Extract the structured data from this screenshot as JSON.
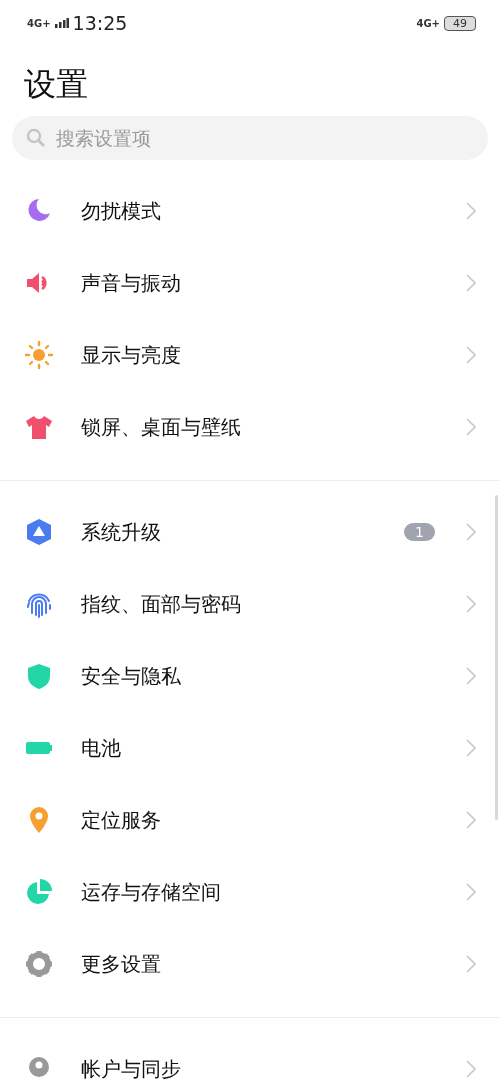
{
  "status_bar": {
    "network_left": "4G+",
    "time": "13:25",
    "network_right": "4G+",
    "battery": "49"
  },
  "title": "设置",
  "search": {
    "placeholder": "搜索设置项"
  },
  "groups": [
    {
      "items": [
        {
          "label": "勿扰模式"
        },
        {
          "label": "声音与振动"
        },
        {
          "label": "显示与亮度"
        },
        {
          "label": "锁屏、桌面与壁纸"
        }
      ]
    },
    {
      "items": [
        {
          "label": "系统升级",
          "badge": "1"
        },
        {
          "label": "指纹、面部与密码"
        },
        {
          "label": "安全与隐私"
        },
        {
          "label": "电池"
        },
        {
          "label": "定位服务"
        },
        {
          "label": "运存与存储空间"
        },
        {
          "label": "更多设置"
        }
      ]
    },
    {
      "items": [
        {
          "label": "帐户与同步"
        }
      ]
    }
  ]
}
